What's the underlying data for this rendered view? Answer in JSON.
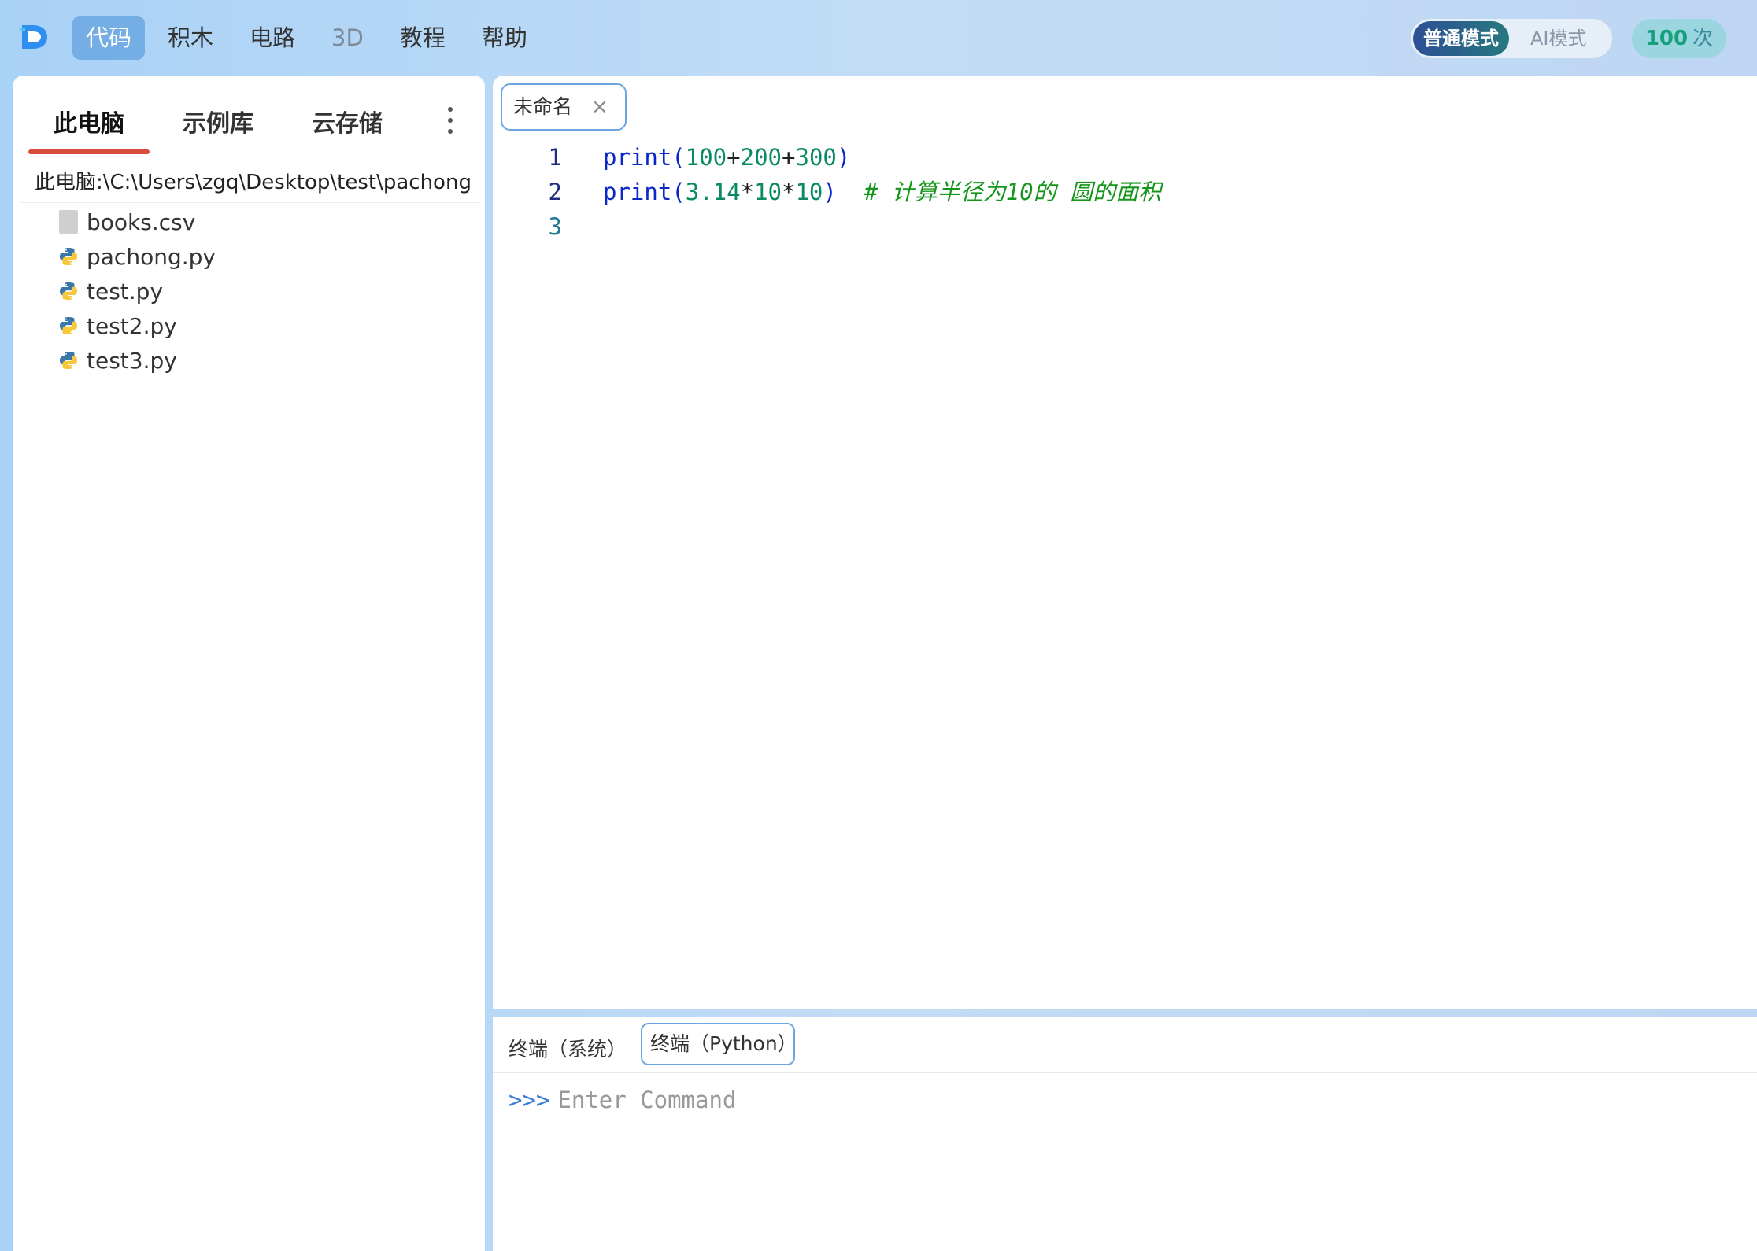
{
  "nav": {
    "items": [
      {
        "label": "代码",
        "active": true
      },
      {
        "label": "积木"
      },
      {
        "label": "电路"
      },
      {
        "label": "3D",
        "muted": true
      },
      {
        "label": "教程"
      },
      {
        "label": "帮助"
      }
    ]
  },
  "mode": {
    "normal": "普通模式",
    "ai": "AI模式"
  },
  "quota": {
    "count": "100",
    "unit": "次"
  },
  "sidebar": {
    "tabs": [
      "此电脑",
      "示例库",
      "云存储"
    ],
    "path": "此电脑:\\C:\\Users\\zgq\\Desktop\\test\\pachong",
    "files": [
      {
        "name": "books.csv",
        "icon": "file-icon"
      },
      {
        "name": "pachong.py",
        "icon": "python-icon"
      },
      {
        "name": "test.py",
        "icon": "python-icon"
      },
      {
        "name": "test2.py",
        "icon": "python-icon"
      },
      {
        "name": "test3.py",
        "icon": "python-icon"
      }
    ]
  },
  "editor": {
    "tab": {
      "label": "未命名",
      "close": "×"
    },
    "lines": [
      {
        "number": "1",
        "tokens": [
          "print(",
          "100",
          "+",
          "200",
          "+",
          "300",
          ")"
        ]
      },
      {
        "number": "2",
        "tokens": [
          "print(",
          "3.14",
          "*",
          "10",
          "*",
          "10",
          ")",
          "# 计算半径为10的 圆的面积"
        ]
      },
      {
        "number": "3"
      }
    ]
  },
  "terminal": {
    "tabs": [
      "终端（系统）",
      "终端（Python）"
    ],
    "prompt": ">>>",
    "placeholder": "Enter Command"
  },
  "colors": {
    "accent": "#74aee4",
    "tab_border": "#6ba6e2",
    "active_underline": "#d94b3b",
    "keyword": "#0c27c9",
    "number": "#0a8a64",
    "comment": "#15961a",
    "quota_number": "#16a07c"
  }
}
